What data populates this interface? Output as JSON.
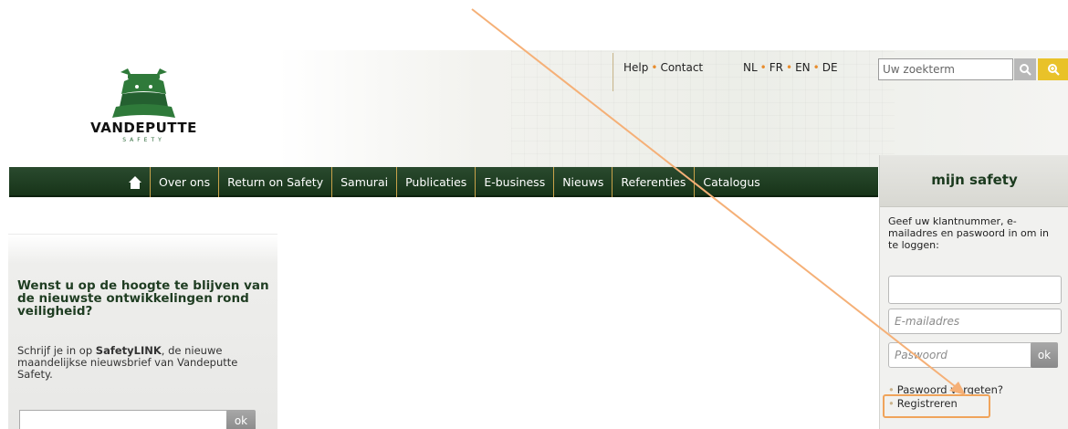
{
  "brand": {
    "name": "VANDEPUTTE",
    "tagline": "SAFETY"
  },
  "header_links": [
    "Help",
    "Contact"
  ],
  "languages": [
    "NL",
    "FR",
    "EN",
    "DE"
  ],
  "search": {
    "placeholder": "Uw zoekterm",
    "button_icon": "search-icon",
    "advanced_icon": "zoom-in-icon"
  },
  "nav": {
    "home_icon": "home-icon",
    "items": [
      "Over ons",
      "Return on Safety",
      "Samurai",
      "Publicaties",
      "E-business",
      "Nieuws",
      "Referenties",
      "Catalogus"
    ]
  },
  "login": {
    "title": "mijn safety",
    "intro": "Geef uw klantnummer, e-mailadres en paswoord in om in te loggen:",
    "customer_number_value": "",
    "email_placeholder": "E-mailadres",
    "password_placeholder": "Paswoord",
    "ok_label": "ok",
    "forgot_link": "Paswoord vergeten?",
    "register_link": "Registreren"
  },
  "newsletter": {
    "heading": "Wenst u op de hoogte te blijven van de nieuwste ontwikkelingen rond veiligheid?",
    "text_before": "Schrijf je in op ",
    "brand_bold": "SafetyLINK",
    "text_after": ", de nieuwe maandelijkse nieuwsbrief van Vandeputte Safety.",
    "ok_label": "ok"
  },
  "colors": {
    "nav_bg": "#1f3f22",
    "accent_orange": "#e88c2c",
    "annotation_orange": "#f0a45b",
    "search_btn": "#e9c229"
  }
}
